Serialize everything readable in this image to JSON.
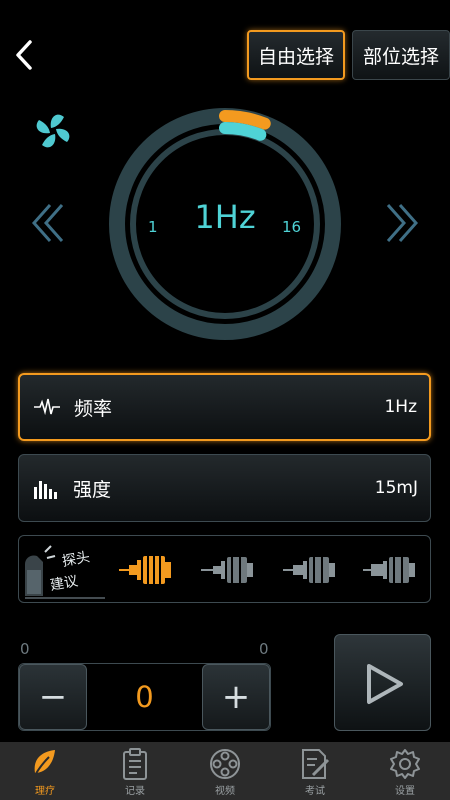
{
  "header": {
    "back_icon": "chevron-left-icon",
    "mode_free_label": "自由选择",
    "mode_part_label": "部位选择"
  },
  "dial": {
    "value_text": "1Hz",
    "min_label": "1",
    "max_label": "16",
    "fraction": 0.06,
    "icon": "fan-icon"
  },
  "params": {
    "frequency": {
      "label": "频率",
      "value": "1Hz",
      "icon": "waveform-icon"
    },
    "intensity": {
      "label": "强度",
      "value": "15mJ",
      "icon": "bars-icon"
    }
  },
  "probes": {
    "suggest_label": [
      "探头",
      "建议"
    ],
    "items": [
      "probe-1",
      "probe-2",
      "probe-3",
      "probe-4",
      "probe-5"
    ],
    "selected_index": 0
  },
  "counter": {
    "left_count": "0",
    "right_count": "0",
    "value": "0",
    "minus_label": "−",
    "plus_label": "+"
  },
  "tabs": [
    {
      "label": "理疗",
      "icon": "leaf-icon"
    },
    {
      "label": "记录",
      "icon": "clipboard-icon"
    },
    {
      "label": "视频",
      "icon": "film-reel-icon"
    },
    {
      "label": "考试",
      "icon": "exam-paper-icon"
    },
    {
      "label": "设置",
      "icon": "gear-icon"
    }
  ],
  "colors": {
    "accent_orange": "#f39a1f",
    "accent_cyan": "#4fd3d6",
    "background": "#000000"
  }
}
